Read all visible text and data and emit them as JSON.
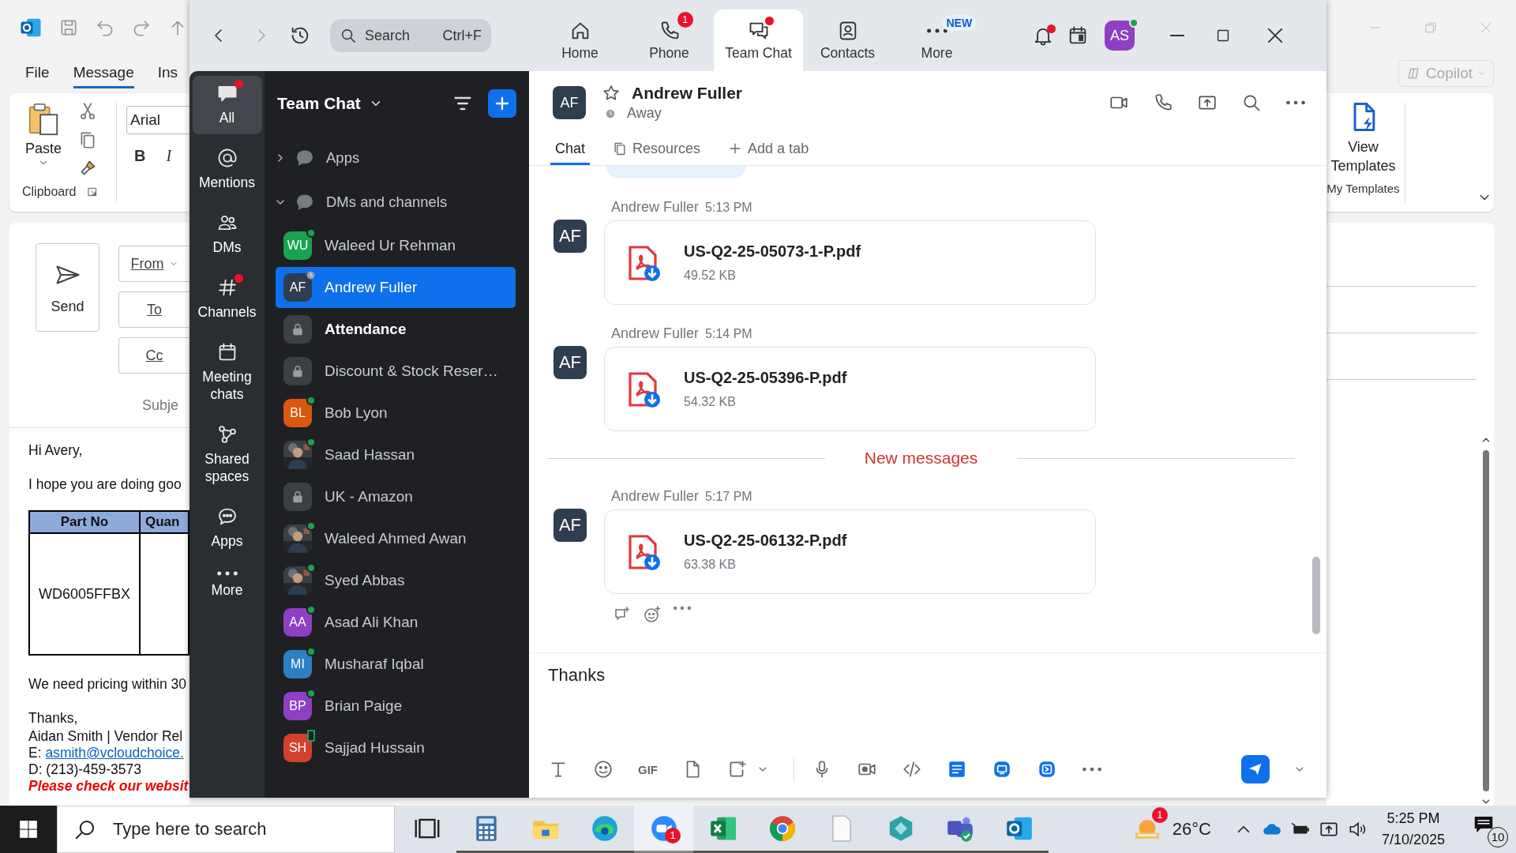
{
  "outlook": {
    "menu_tabs": [
      {
        "label": "File",
        "selected": false
      },
      {
        "label": "Message",
        "selected": true
      },
      {
        "label": "Ins",
        "selected": false
      }
    ],
    "ribbon": {
      "paste": "Paste",
      "clipboard": "Clipboard",
      "font": "Arial",
      "bold": "B",
      "italic": "I",
      "copilot": "Copilot",
      "templates_button": "View Templates",
      "templates_group": "My Templates"
    },
    "compose": {
      "send": "Send",
      "address_buttons": [
        "From",
        "To",
        "Cc"
      ],
      "subject_label": "Subje"
    },
    "body": {
      "greeting": "Hi Avery,",
      "intro": "I hope you are doing goo",
      "table": {
        "columns": [
          "Part No",
          "Quan"
        ],
        "rows": [
          [
            "WD6005FFBX"
          ]
        ]
      },
      "request": "We need pricing within 30",
      "closing": "Thanks,",
      "signature": [
        {
          "kind": "text",
          "text": "Aidan Smith | Vendor Rel"
        },
        {
          "kind": "link",
          "prefix": "E: ",
          "link": "asmith@vcloudchoice."
        },
        {
          "kind": "text",
          "text": "D: (213)-459-3573"
        },
        {
          "kind": "notice",
          "text": "Please check our websit"
        }
      ]
    }
  },
  "zoom": {
    "search": {
      "placeholder": "Search",
      "shortcut": "Ctrl+F"
    },
    "nav": [
      {
        "kind": "home",
        "label": "Home",
        "selected": false,
        "dot": false
      },
      {
        "kind": "phone",
        "label": "Phone",
        "selected": false,
        "dot": false,
        "badge": "1"
      },
      {
        "kind": "chat",
        "label": "Team Chat",
        "selected": true,
        "dot": true
      },
      {
        "kind": "contacts",
        "label": "Contacts",
        "selected": false,
        "dot": false
      },
      {
        "kind": "more",
        "label": "More",
        "selected": false,
        "dot": false,
        "tag": "NEW"
      }
    ],
    "notifications_dot": true,
    "profile": {
      "initials": "AS",
      "online": true
    },
    "rail": [
      {
        "kind": "all",
        "label": "All",
        "selected": true,
        "dot": true
      },
      {
        "kind": "mentions",
        "label": "Mentions",
        "selected": false,
        "dot": false
      },
      {
        "kind": "dms",
        "label": "DMs",
        "selected": false,
        "dot": false
      },
      {
        "kind": "channels",
        "label": "Channels",
        "selected": false,
        "dot": true
      },
      {
        "kind": "meetings",
        "label": "Meeting chats",
        "selected": false,
        "dot": false
      },
      {
        "kind": "shared",
        "label": "Shared spaces",
        "selected": false,
        "dot": false
      },
      {
        "kind": "apps",
        "label": "Apps",
        "selected": false,
        "dot": false
      },
      {
        "kind": "more",
        "label": "More",
        "selected": false,
        "dot": false
      }
    ],
    "chat_list": {
      "title": "Team Chat",
      "sections": [
        {
          "label": "Apps",
          "expanded": false
        },
        {
          "label": "DMs and channels",
          "expanded": true,
          "children": [
            {
              "kind": "initials",
              "name": "Waleed Ur Rehman",
              "initials": "WU",
              "color": "#1aa251",
              "online": true,
              "away": false,
              "mobile": false,
              "selected": false,
              "unread": false
            },
            {
              "kind": "initials",
              "name": "Andrew Fuller",
              "initials": "AF",
              "color": "#2e3d4f",
              "online": false,
              "away": true,
              "mobile": false,
              "selected": true,
              "unread": false
            },
            {
              "kind": "channel",
              "name": "Attendance",
              "online": false,
              "away": false,
              "mobile": false,
              "selected": false,
              "unread": true
            },
            {
              "kind": "channel",
              "name": "Discount & Stock Reser…",
              "online": false,
              "away": false,
              "mobile": false,
              "selected": false,
              "unread": false
            },
            {
              "kind": "initials",
              "name": "Bob Lyon",
              "initials": "BL",
              "color": "#d9570e",
              "online": true,
              "away": false,
              "mobile": false,
              "selected": false,
              "unread": false
            },
            {
              "name": "Saad Hassan",
              "online": true,
              "away": false,
              "mobile": false,
              "selected": false,
              "unread": false
            },
            {
              "kind": "channel",
              "name": "UK - Amazon",
              "online": false,
              "away": false,
              "mobile": false,
              "selected": false,
              "unread": false
            },
            {
              "name": "Waleed Ahmed Awan",
              "online": true,
              "away": false,
              "mobile": false,
              "selected": false,
              "unread": false
            },
            {
              "name": "Syed Abbas",
              "online": true,
              "away": false,
              "mobile": false,
              "selected": false,
              "unread": false
            },
            {
              "kind": "initials",
              "name": "Asad Ali Khan",
              "initials": "AA",
              "color": "#8e3fc2",
              "online": true,
              "away": false,
              "mobile": false,
              "selected": false,
              "unread": false
            },
            {
              "kind": "initials",
              "name": "Musharaf Iqbal",
              "initials": "MI",
              "color": "#2d7fc1",
              "online": true,
              "away": false,
              "mobile": false,
              "selected": false,
              "unread": false
            },
            {
              "kind": "initials",
              "name": "Brian Paige",
              "initials": "BP",
              "color": "#8e3fc2",
              "online": true,
              "away": false,
              "mobile": false,
              "selected": false,
              "unread": false
            },
            {
              "kind": "initials",
              "name": "Sajjad Hussain",
              "initials": "SH",
              "color": "#d3402b",
              "online": false,
              "away": false,
              "mobile": true,
              "selected": false,
              "unread": false
            }
          ]
        }
      ]
    },
    "conversation": {
      "contact": {
        "initials": "AF",
        "name": "Andrew Fuller",
        "status": "Away",
        "starred": false
      },
      "tabs": [
        {
          "kind": "chat",
          "label": "Chat",
          "selected": true
        },
        {
          "kind": "resources",
          "label": "Resources",
          "selected": false
        },
        {
          "kind": "add",
          "label": "Add a tab",
          "selected": false
        }
      ],
      "messages": [
        {
          "kind": "file",
          "sender": "Andrew Fuller",
          "time": "5:13 PM",
          "initials": "AF",
          "file": "US-Q2-25-05073-1-P.pdf",
          "size": "49.52 KB"
        },
        {
          "kind": "file",
          "sender": "Andrew Fuller",
          "time": "5:14 PM",
          "initials": "AF",
          "file": "US-Q2-25-05396-P.pdf",
          "size": "54.32 KB"
        },
        {
          "kind": "divider",
          "label": "New messages"
        },
        {
          "kind": "file",
          "sender": "Andrew Fuller",
          "time": "5:17 PM",
          "initials": "AF",
          "file": "US-Q2-25-06132-P.pdf",
          "size": "63.38 KB"
        }
      ],
      "composer": {
        "value": "Thanks",
        "toolbar": [
          {
            "kind": "format"
          },
          {
            "kind": "emoji"
          },
          {
            "kind": "gif",
            "label": "GIF"
          },
          {
            "kind": "file"
          },
          {
            "kind": "screenshot"
          },
          {
            "kind": "caret"
          },
          {
            "kind": "separator"
          },
          {
            "kind": "mic"
          },
          {
            "kind": "video"
          },
          {
            "kind": "code"
          },
          {
            "kind": "doc"
          },
          {
            "kind": "whiteboard"
          },
          {
            "kind": "clip"
          },
          {
            "kind": "more"
          }
        ]
      }
    }
  },
  "taskbar": {
    "search_placeholder": "Type here to search",
    "apps": [
      {
        "kind": "taskview",
        "running": false,
        "selected": false
      },
      {
        "kind": "calculator",
        "running": true,
        "selected": false
      },
      {
        "kind": "explorer",
        "running": true,
        "selected": false
      },
      {
        "kind": "edge",
        "running": true,
        "selected": false
      },
      {
        "kind": "zoom",
        "running": true,
        "selected": true,
        "badge": "1"
      },
      {
        "kind": "excel",
        "running": true,
        "selected": false
      },
      {
        "kind": "chrome",
        "running": true,
        "selected": false
      },
      {
        "kind": "notepad",
        "running": true,
        "selected": false
      },
      {
        "kind": "app",
        "running": true,
        "selected": false
      },
      {
        "kind": "teams",
        "running": true,
        "selected": false
      },
      {
        "kind": "outlook",
        "running": true,
        "selected": false
      }
    ],
    "weather": {
      "temp": "26°C",
      "badge": "1"
    },
    "clock": {
      "time": "5:25 PM",
      "date": "7/10/2025"
    },
    "notifications": "10"
  }
}
